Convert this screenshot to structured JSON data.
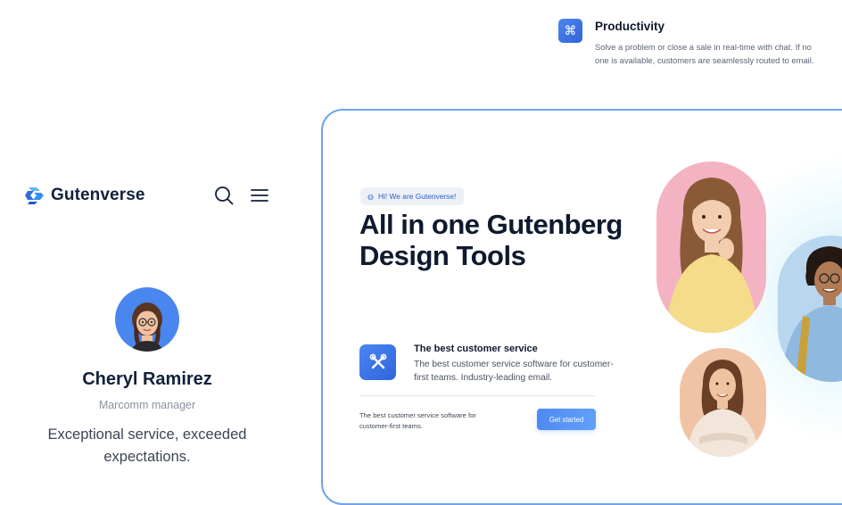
{
  "feature": {
    "icon": "command-icon",
    "icon_glyph": "⌘",
    "title": "Productivity",
    "description": "Solve a problem or close a sale in real-time with chat. If no one is available, customers are seamlessly routed to email."
  },
  "mobile": {
    "brand": "Gutenverse",
    "testimonial": {
      "name": "Cheryl Ramirez",
      "role": "Marcomm manager",
      "quote": "Exceptional service, exceeded expectations."
    }
  },
  "hero": {
    "badge": "Hi! We are Gutenverse!",
    "title": "All in one Gutenberg Design Tools",
    "service_title": "The best customer service",
    "service_description": "The best customer service software for customer-first teams. Industry-leading email.",
    "small_description": "The best customer service software for customer-first teams.",
    "cta_label": "Get started"
  },
  "colors": {
    "accent": "#3f7cea",
    "frame_border": "#6fa3ee",
    "text_dark": "#0f1a2e"
  }
}
